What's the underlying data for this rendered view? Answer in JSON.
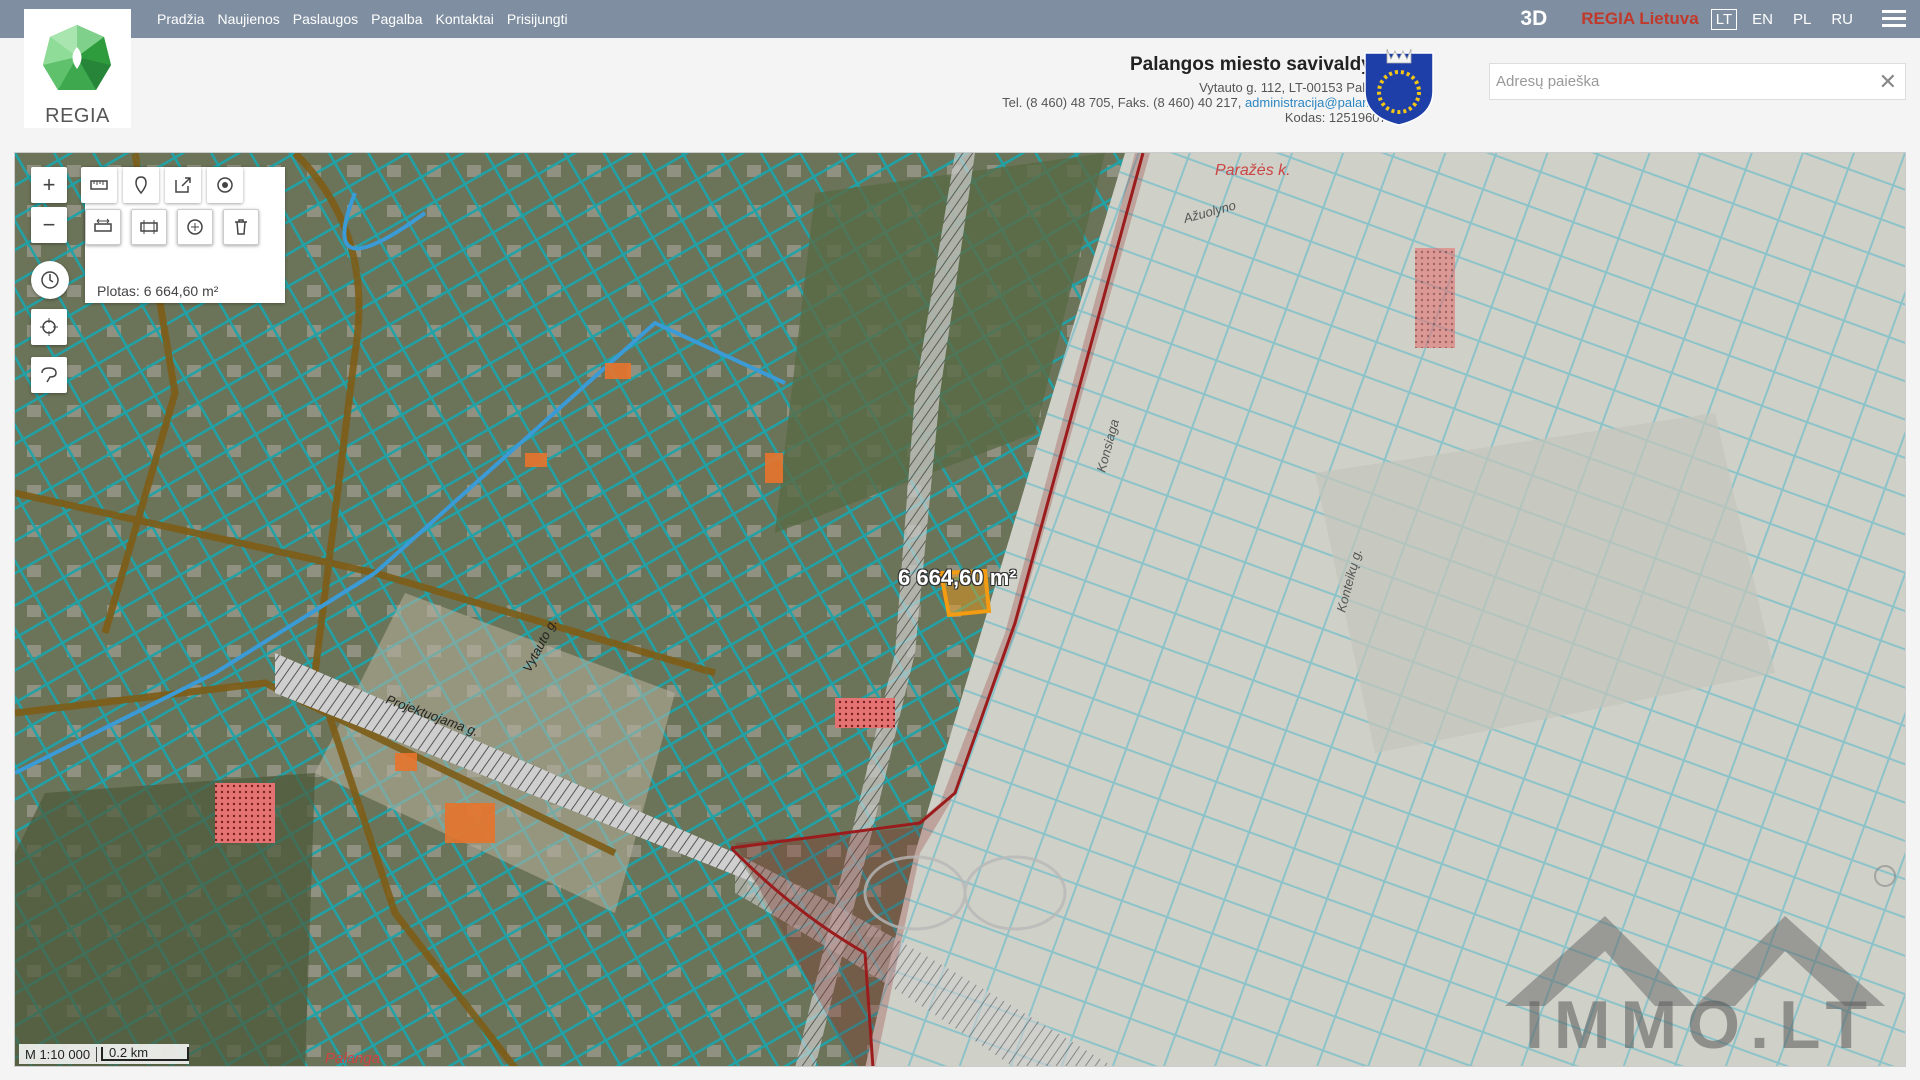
{
  "nav": {
    "items": [
      "Pradžia",
      "Naujienos",
      "Paslaugos",
      "Pagalba",
      "Kontaktai",
      "Prisijungti"
    ]
  },
  "top_right": {
    "btn_3d": "3D",
    "regia_link": "REGIA Lietuva",
    "languages": [
      "LT",
      "EN",
      "PL",
      "RU"
    ],
    "active_language": "LT"
  },
  "logo": {
    "text": "REGIA"
  },
  "municipality": {
    "title": "Palangos miesto savivaldybė",
    "address": "Vytauto g. 112, LT-00153 Palanga",
    "phones": "Tel. (8 460) 48 705, Faks. (8 460) 40 217,",
    "email": "administracija@palanga.lt",
    "code": "Kodas: 125196077"
  },
  "search": {
    "placeholder": "Adresų paieška",
    "value": ""
  },
  "map": {
    "area_readout": "Plotas: 6 664,60 m²",
    "area_label": "6 664,60 m²",
    "scale_ratio": "M 1:10 000",
    "scale_distance": "0.2 km",
    "street_labels": [
      "Vytauto g.",
      "Projektuojama g.",
      "Konsiaga",
      "Konteikų g.",
      "Paražės k.",
      "Ažuolyno",
      "Palanga"
    ],
    "watermark": "IMMO.LT",
    "colors": {
      "parcel_lines": "#1fa3a8",
      "roads": "#8a6a1a",
      "boundary": "#8b1a1a",
      "measured_parcel": "#f39c12"
    }
  },
  "tools": {
    "zoom_in": "zoom-in",
    "zoom_out": "zoom-out",
    "measure": "ruler",
    "pin": "map-pin",
    "export": "export",
    "target": "target",
    "measure_distance": "measure-distance",
    "measure_area": "measure-area",
    "pan": "pan",
    "delete": "trash",
    "history": "clock",
    "locate": "crosshair",
    "lasso": "lasso"
  }
}
